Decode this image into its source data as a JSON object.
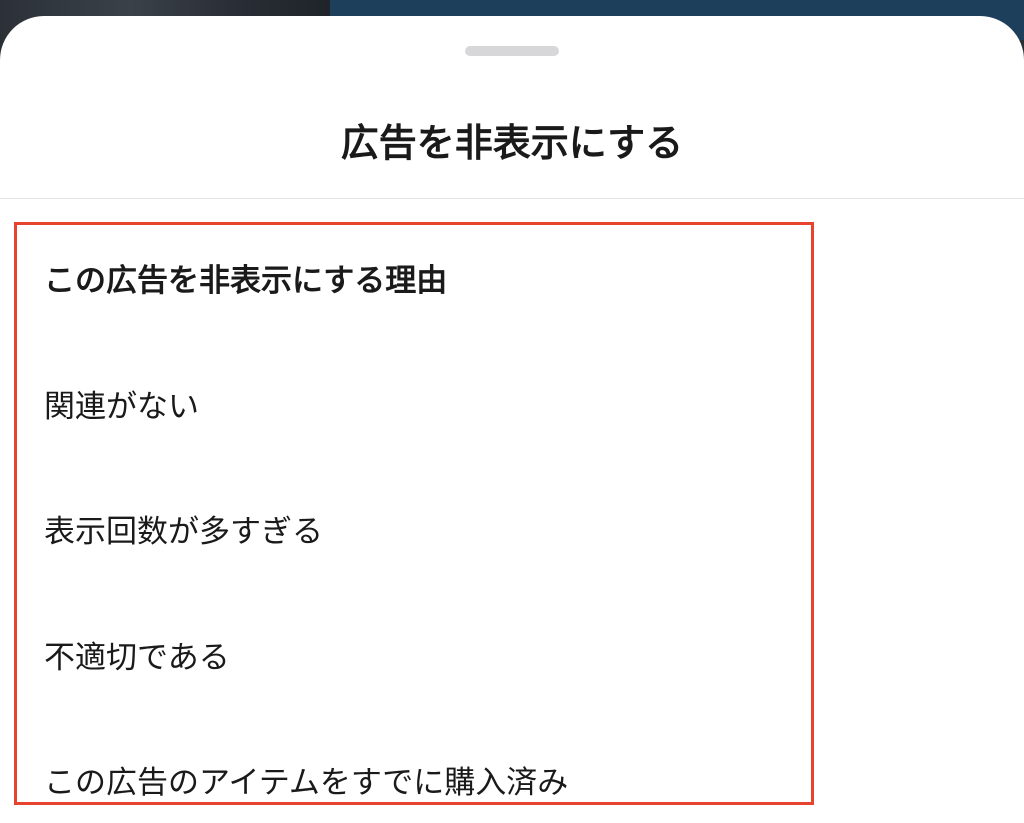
{
  "sheet": {
    "title": "広告を非表示にする"
  },
  "reasons": {
    "heading": "この広告を非表示にする理由",
    "items": [
      "関連がない",
      "表示回数が多すぎる",
      "不適切である",
      "この広告のアイテムをすでに購入済み"
    ]
  },
  "colors": {
    "highlight_border": "#e8432f",
    "sheet_background": "#ffffff",
    "grabber": "#d7d7d9",
    "text": "#1a1a1a"
  }
}
